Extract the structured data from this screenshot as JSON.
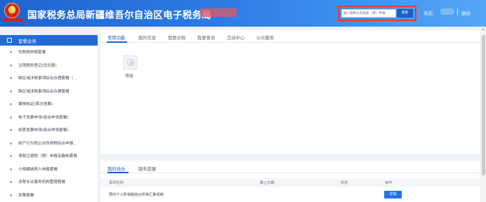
{
  "header": {
    "site_title": "国家税务总局新疆维吾尔自治区电子税务局",
    "search": {
      "placeholder": "输入税种以及搜索（费）申报",
      "button_label": "搜索"
    },
    "welcome_label": "欢迎,",
    "logout_label": "退出"
  },
  "sidebar": {
    "title": "套餐业务",
    "items": [
      {
        "label": "车购税申报套餐"
      },
      {
        "label": "注销税务登记(优化版)"
      },
      {
        "label": "跨区域涉税事项综合办理套餐（..."
      },
      {
        "label": "跨区域涉税事项综合办理套餐"
      },
      {
        "label": "票种核定(首次领票)"
      },
      {
        "label": "电子发票申领(组合申领套餐)"
      },
      {
        "label": "纸质发票申领(组合申领套餐)"
      },
      {
        "label": "财产行为税企业所得税综合申报..."
      },
      {
        "label": "清税注销税（费）申报及缴纳套餐"
      },
      {
        "label": "小规模纳税人申报套餐"
      },
      {
        "label": "涉税专业服务机构管理套餐"
      },
      {
        "label": "发票套餐"
      }
    ]
  },
  "main": {
    "tabs": [
      {
        "label": "常用功能",
        "active": true
      },
      {
        "label": "我的信息",
        "active": false
      },
      {
        "label": "我要办税",
        "active": false
      },
      {
        "label": "我要查询",
        "active": false
      },
      {
        "label": "互动中心",
        "active": false
      },
      {
        "label": "公众服务",
        "active": false
      }
    ],
    "add_label": "添加"
  },
  "todo": {
    "tabs": [
      {
        "label": "我的待办",
        "active": true
      },
      {
        "label": "服务提醒",
        "active": false
      }
    ],
    "columns": [
      "事项名称",
      "截止日期",
      "状态",
      "操作"
    ],
    "rows": [
      {
        "name": "预约个人所得税综合所得汇算清缴",
        "deadline": "",
        "status": "",
        "action": "详情"
      }
    ]
  },
  "colors": {
    "header_blue": "#2469d6",
    "accent": "#1c5fc4",
    "highlight_border": "#e23b3b"
  }
}
